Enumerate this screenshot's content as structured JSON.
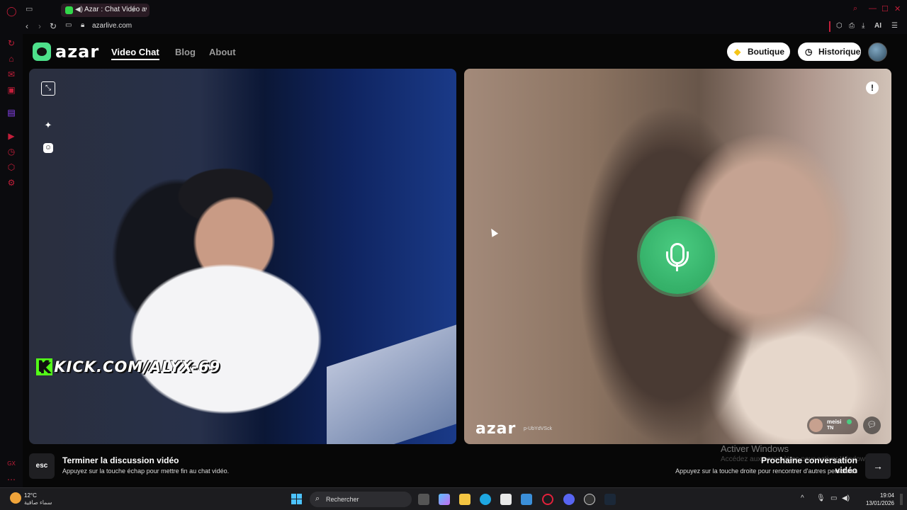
{
  "browser": {
    "tab_title": "Azar : Chat Vidéo avec",
    "url": "azarlive.com",
    "ai_label": "AI"
  },
  "site": {
    "logo": "azar",
    "nav": [
      {
        "label": "Video Chat",
        "active": true
      },
      {
        "label": "Blog",
        "active": false
      },
      {
        "label": "About",
        "active": false
      }
    ],
    "boutique_label": "Boutique",
    "historique_label": "Historique"
  },
  "local_video": {
    "kick_text": "KICK.COM/ALYX-69",
    "kick_letter": "K"
  },
  "remote_video": {
    "logo": "azar",
    "id_text": "p-UbYdVSck",
    "user_name": "meisi",
    "user_country": "TN"
  },
  "bottom": {
    "esc_label": "esc",
    "end_title": "Terminer la discussion vidéo",
    "end_sub": "Appuyez sur la touche échap pour mettre fin au chat vidéo.",
    "next_title": "Prochaine conversation vidéo",
    "next_sub": "Appuyez sur la touche droite pour rencontrer d'autres personnes",
    "activate_title": "Activer Windows",
    "activate_sub": "Accédez aux paramètres pour activer Windows."
  },
  "taskbar": {
    "weather_temp": "12°C",
    "weather_desc": "سماء صافية",
    "search_label": "Rechercher",
    "time": "19:04",
    "date": "13/01/2026"
  },
  "colors": {
    "accent_green": "#3fd07c",
    "opera_red": "#c41e3a",
    "kick_green": "#53fc18"
  }
}
